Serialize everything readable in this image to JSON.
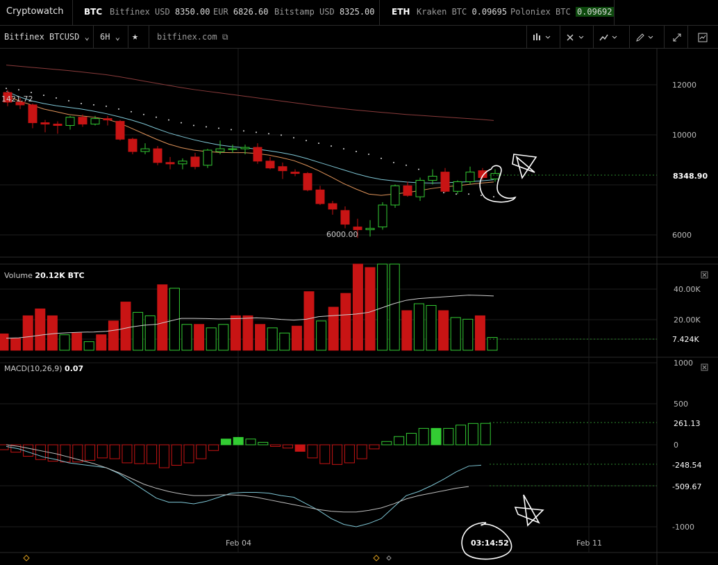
{
  "app": {
    "title": "Cryptowatch"
  },
  "ticker": {
    "btc": {
      "label": "BTC",
      "items": [
        {
          "exchange": "Bitfinex USD",
          "price": "8350.00"
        },
        {
          "exchange": "EUR",
          "price": "6826.60"
        },
        {
          "exchange": "Bitstamp USD",
          "price": "8325.00"
        }
      ]
    },
    "eth": {
      "label": "ETH",
      "items": [
        {
          "exchange": "Kraken BTC",
          "price": "0.09695"
        },
        {
          "exchange": "Poloniex BTC",
          "price": "0.09692"
        }
      ]
    }
  },
  "toolbar": {
    "market": "Bitfinex BTCUSD",
    "period": "6H",
    "link": "bitfinex.com",
    "chevron": "⌄",
    "icons": [
      "candles-icon",
      "cross-icon",
      "indicator-icon",
      "pencil-icon",
      "expand-icon",
      "screenshot-icon"
    ]
  },
  "price_pane": {
    "y_ticks": [
      "12000",
      "10000",
      "6000"
    ],
    "current_price": "8348.90",
    "high_label": "1421.72",
    "low_label": "6000.00"
  },
  "volume_pane": {
    "title": "Volume",
    "value": "20.12K BTC",
    "y_ticks": [
      "40.00K",
      "20.00K"
    ],
    "current": "7.424K"
  },
  "macd_pane": {
    "title": "MACD(10,26,9)",
    "value": "0.07",
    "y_ticks": [
      "1000",
      "500",
      "0",
      "-1000"
    ],
    "hist_label": "261.13",
    "macd_label": "-248.54",
    "signal_label": "-509.67"
  },
  "time_axis": {
    "labels": [
      "Feb 04",
      "Feb 11"
    ],
    "cursor_time": "03:14:52"
  },
  "colors": {
    "up": "#33cc33",
    "down": "#c81414",
    "ma_cyan": "#7fc7d6",
    "ma_orange": "#e0945a",
    "ma_red": "#8a3b3b",
    "grid": "#1e1e1e"
  },
  "chart_data": [
    {
      "type": "candlestick",
      "y_range": [
        5300,
        12900
      ],
      "candles": [
        [
          11300,
          11400,
          10800,
          10950
        ],
        [
          10950,
          11100,
          10700,
          10850
        ],
        [
          10850,
          10900,
          10000,
          10200
        ],
        [
          10200,
          10300,
          9850,
          10150
        ],
        [
          10150,
          10250,
          9800,
          10100
        ],
        [
          10100,
          10450,
          9950,
          10400
        ],
        [
          10400,
          10500,
          10050,
          10150
        ],
        [
          10150,
          10450,
          10100,
          10350
        ],
        [
          10350,
          10450,
          10100,
          10300
        ],
        [
          10250,
          10300,
          9550,
          9600
        ],
        [
          9600,
          9650,
          9050,
          9150
        ],
        [
          9150,
          9450,
          9050,
          9250
        ],
        [
          9250,
          9350,
          8650,
          8750
        ],
        [
          8750,
          8950,
          8500,
          8700
        ],
        [
          8700,
          8900,
          8500,
          8800
        ],
        [
          8950,
          9100,
          8500,
          8600
        ],
        [
          8650,
          9250,
          8550,
          9200
        ],
        [
          9150,
          9550,
          9050,
          9250
        ],
        [
          9250,
          9400,
          9100,
          9250
        ],
        [
          9250,
          9400,
          9050,
          9300
        ],
        [
          9300,
          9450,
          8700,
          8800
        ],
        [
          8800,
          8950,
          8500,
          8550
        ],
        [
          8600,
          8750,
          8150,
          8450
        ],
        [
          8400,
          8500,
          8250,
          8350
        ],
        [
          8350,
          8400,
          7700,
          7750
        ],
        [
          7750,
          7900,
          7200,
          7250
        ],
        [
          7250,
          7350,
          6850,
          7050
        ],
        [
          7000,
          7150,
          6350,
          6500
        ],
        [
          6400,
          6700,
          6000,
          6300
        ],
        [
          6300,
          6650,
          6050,
          6350
        ],
        [
          6400,
          7300,
          6300,
          7200
        ],
        [
          7200,
          7950,
          7100,
          7900
        ],
        [
          7900,
          8050,
          7500,
          7550
        ],
        [
          7500,
          8200,
          7350,
          8100
        ],
        [
          8100,
          8500,
          7950,
          8250
        ],
        [
          8400,
          8550,
          7650,
          7700
        ],
        [
          7700,
          8100,
          7600,
          8050
        ],
        [
          8050,
          8600,
          7950,
          8400
        ],
        [
          8450,
          8550,
          8100,
          8200
        ],
        [
          8150,
          8500,
          8050,
          8350
        ]
      ],
      "ma_cyan": [
        11350,
        11150,
        11000,
        10900,
        10820,
        10760,
        10700,
        10620,
        10530,
        10420,
        10300,
        10160,
        9990,
        9830,
        9700,
        9580,
        9480,
        9390,
        9330,
        9290,
        9240,
        9180,
        9110,
        9020,
        8900,
        8760,
        8620,
        8480,
        8340,
        8220,
        8130,
        8080,
        8040,
        8010,
        8000,
        8010,
        8030,
        8050,
        8080,
        8120
      ],
      "ma_orange": [
        11200,
        11000,
        10850,
        10700,
        10600,
        10500,
        10450,
        10400,
        10330,
        10200,
        10000,
        9800,
        9600,
        9420,
        9290,
        9200,
        9150,
        9120,
        9110,
        9110,
        9080,
        9020,
        8930,
        8820,
        8650,
        8450,
        8220,
        7980,
        7780,
        7600,
        7550,
        7600,
        7650,
        7720,
        7800,
        7860,
        7900,
        7950,
        8000,
        8040
      ],
      "ma_red": [
        12300,
        12260,
        12220,
        12180,
        12140,
        12100,
        12050,
        12000,
        11950,
        11880,
        11800,
        11720,
        11640,
        11560,
        11480,
        11410,
        11350,
        11290,
        11230,
        11170,
        11110,
        11050,
        10990,
        10930,
        10870,
        10810,
        10760,
        10710,
        10660,
        10620,
        10580,
        10540,
        10500,
        10470,
        10440,
        10410,
        10380,
        10350,
        10320,
        10280
      ],
      "psar": [
        11450,
        11400,
        11300,
        11200,
        11100,
        11000,
        10900,
        10850,
        10800,
        10700,
        10600,
        10500,
        10400,
        10300,
        10200,
        10100,
        10050,
        10000,
        9950,
        9900,
        9850,
        9800,
        9750,
        9650,
        9550,
        9450,
        9350,
        9250,
        9150,
        9050,
        8900,
        8750,
        8650,
        8500,
        null,
        7650,
        7600,
        7600,
        7550,
        7500
      ]
    },
    {
      "type": "bar",
      "y_range": [
        0,
        50000
      ],
      "values": [
        9500,
        7000,
        20000,
        24000,
        20000,
        9000,
        10000,
        5000,
        9000,
        17000,
        28000,
        22000,
        20000,
        38000,
        36000,
        15000,
        15000,
        13000,
        15000,
        20000,
        20000,
        15000,
        13000,
        10000,
        14000,
        34000,
        17000,
        25000,
        33000,
        52000,
        48000,
        51000,
        50000,
        23000,
        27000,
        26000,
        23000,
        19000,
        18000,
        20000,
        7424
      ],
      "ma": [
        7000,
        7200,
        8000,
        9000,
        9800,
        10200,
        10500,
        10600,
        11000,
        12000,
        13500,
        14500,
        15000,
        16800,
        18500,
        18500,
        18400,
        18200,
        18300,
        18500,
        18800,
        18500,
        17900,
        17500,
        18000,
        19500,
        20000,
        20500,
        21000,
        22000,
        24500,
        27000,
        29000,
        30000,
        30500,
        31000,
        31500,
        32000,
        31800,
        31500
      ],
      "up": [
        false,
        false,
        false,
        false,
        false,
        true,
        false,
        true,
        false,
        false,
        false,
        true,
        true,
        false,
        true,
        true,
        false,
        true,
        true,
        false,
        false,
        false,
        true,
        true,
        false,
        false,
        true,
        false,
        false,
        false,
        false,
        true,
        true,
        false,
        true,
        true,
        false,
        true,
        true,
        false,
        true
      ]
    },
    {
      "type": "macd",
      "y_range": [
        -1150,
        1060
      ],
      "histogram": [
        -60,
        -90,
        -140,
        -180,
        -200,
        -210,
        -210,
        -190,
        -160,
        -170,
        -220,
        -230,
        -230,
        -280,
        -250,
        -220,
        -170,
        -70,
        70,
        90,
        70,
        30,
        -20,
        -40,
        -80,
        -160,
        -230,
        -240,
        -220,
        -170,
        -50,
        40,
        100,
        140,
        200,
        200,
        200,
        240,
        260,
        261
      ],
      "macd": [
        -20,
        -50,
        -100,
        -150,
        -180,
        -220,
        -240,
        -260,
        -280,
        -350,
        -450,
        -550,
        -650,
        -700,
        -700,
        -720,
        -690,
        -640,
        -590,
        -580,
        -580,
        -590,
        -620,
        -640,
        -720,
        -800,
        -900,
        -970,
        -1000,
        -960,
        -900,
        -760,
        -620,
        -570,
        -500,
        -420,
        -330,
        -260,
        -248.54
      ],
      "signal": [
        0,
        -20,
        -50,
        -80,
        -110,
        -150,
        -190,
        -230,
        -280,
        -340,
        -410,
        -480,
        -530,
        -570,
        -600,
        -620,
        -620,
        -610,
        -610,
        -620,
        -640,
        -670,
        -700,
        -730,
        -760,
        -790,
        -810,
        -820,
        -820,
        -800,
        -770,
        -720,
        -660,
        -620,
        -590,
        -560,
        -530,
        -509.67
      ]
    }
  ]
}
